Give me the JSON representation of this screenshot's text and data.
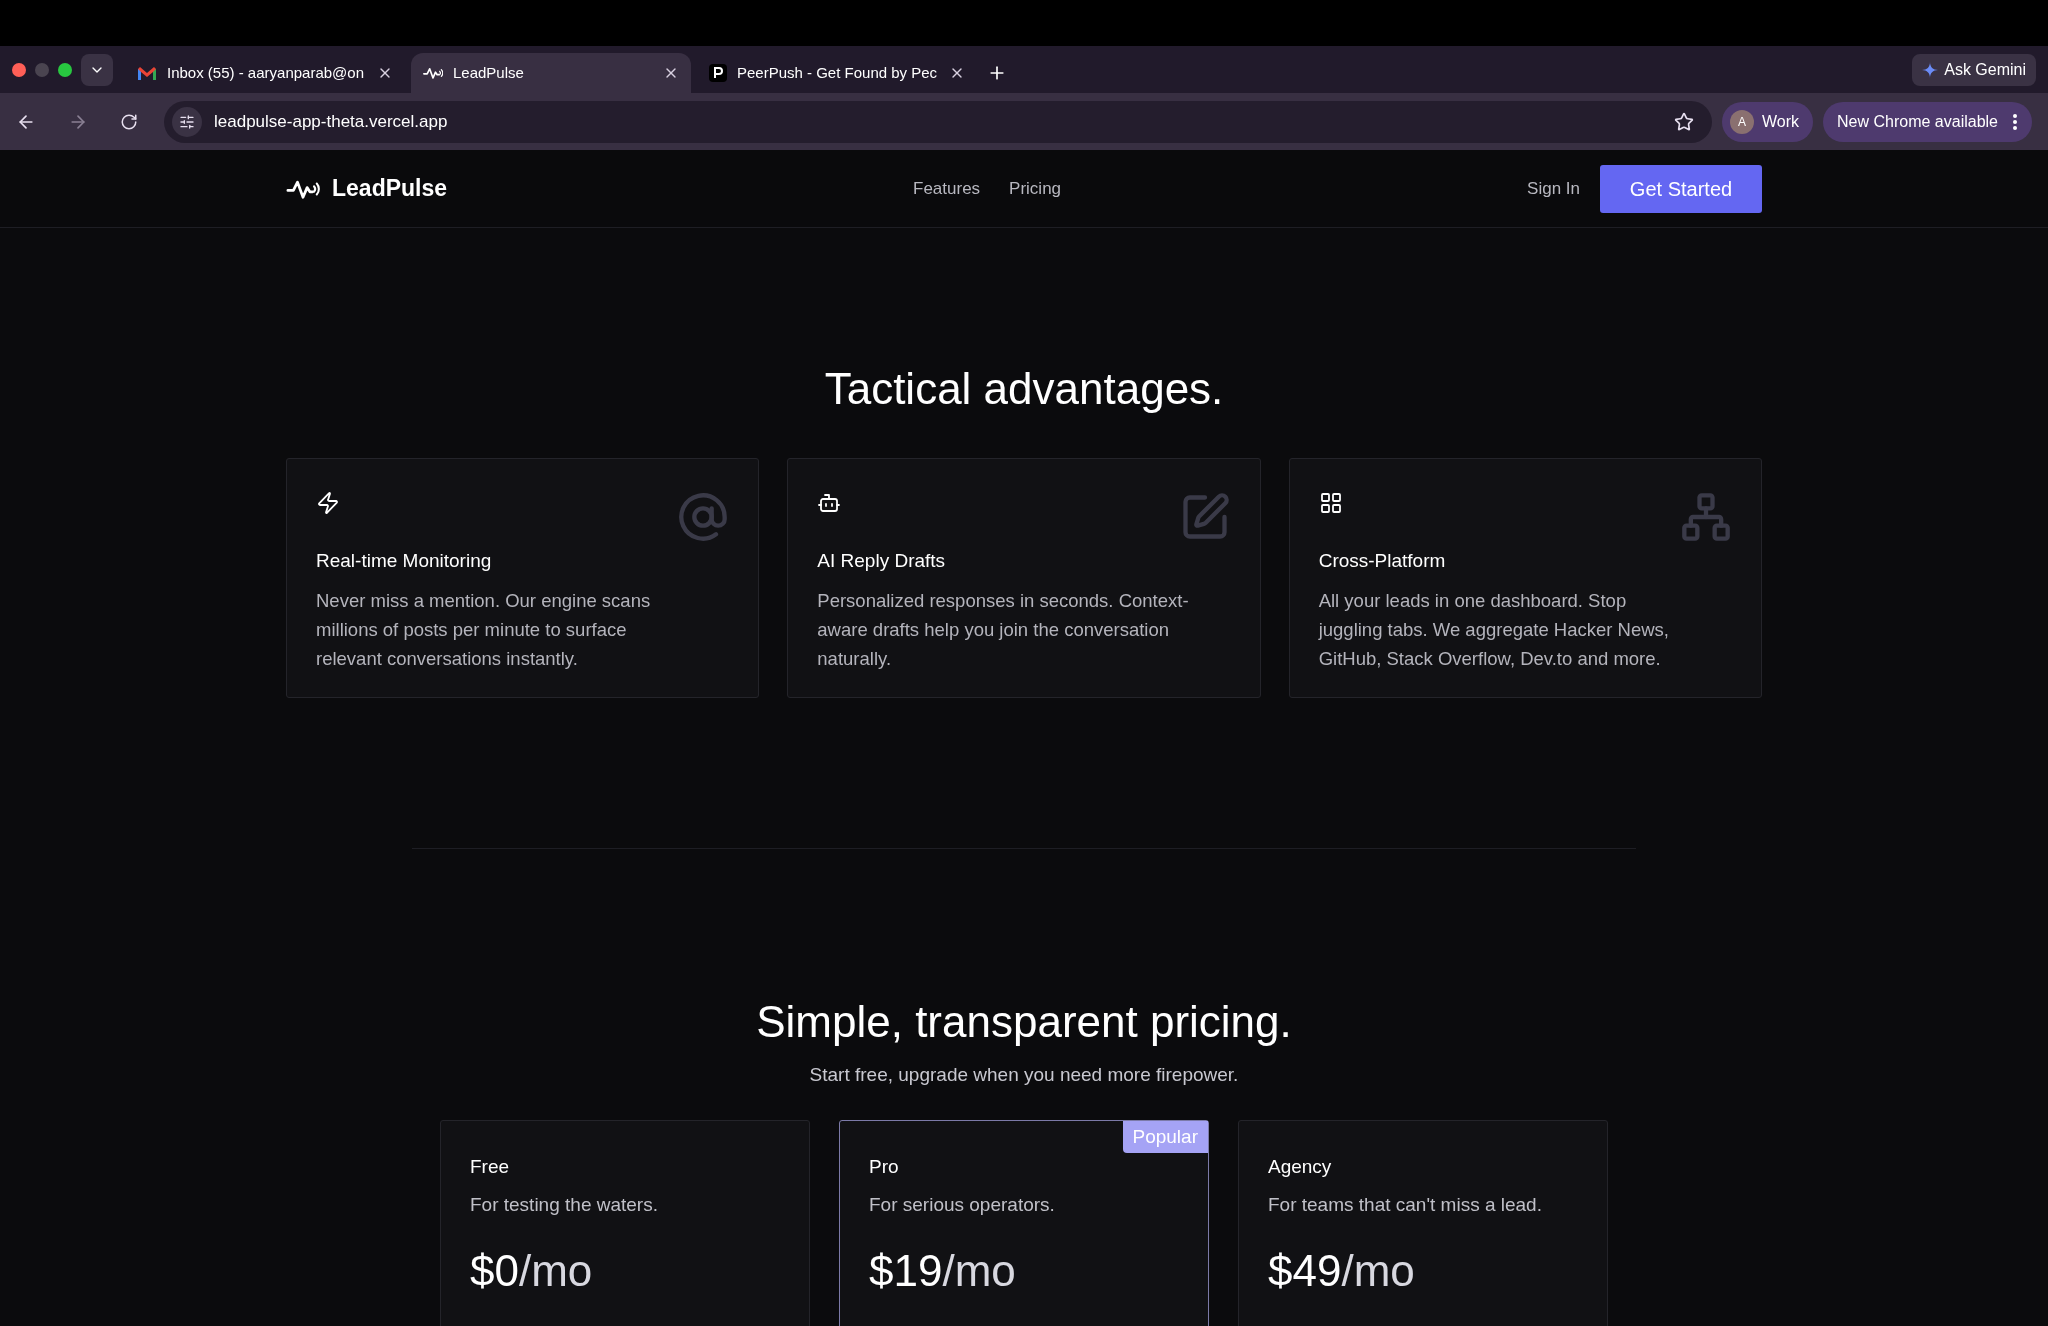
{
  "browser": {
    "tabs": [
      {
        "kind": "mail",
        "title": "Inbox (55) - aaryanparab@on",
        "selected": false
      },
      {
        "kind": "pulse",
        "title": "LeadPulse",
        "selected": true
      },
      {
        "kind": "peer",
        "title": "PeerPush - Get Found by Pec",
        "selected": false
      }
    ],
    "gemini": "Ask Gemini",
    "url": "leadpulse-app-theta.vercel.app",
    "profile_initial": "A",
    "profile": "Work",
    "update": "New Chrome available"
  },
  "nav": {
    "brand": "LeadPulse",
    "links": [
      "Features",
      "Pricing"
    ],
    "sign_in": "Sign In",
    "cta": "Get Started"
  },
  "features": {
    "title": "Tactical advantages.",
    "cards": [
      {
        "kind": "monitor",
        "title": "Real-time Monitoring",
        "text": "Never miss a mention. Our engine scans millions of posts per minute to surface relevant conversations instantly."
      },
      {
        "kind": "ai",
        "title": "AI Reply Drafts",
        "text": "Personalized responses in seconds. Context-aware drafts help you join the conversation naturally."
      },
      {
        "kind": "platform",
        "title": "Cross-Platform",
        "text": "All your leads in one dashboard. Stop juggling tabs. We aggregate Hacker News, GitHub, Stack Overflow, Dev.to and more."
      }
    ]
  },
  "pricing": {
    "title": "Simple, transparent pricing.",
    "subtitle": "Start free, upgrade when you need more firepower.",
    "plans": [
      {
        "name": "Free",
        "tagline": "For testing the waters.",
        "price": "$0",
        "period": "/mo",
        "highlighted": false
      },
      {
        "name": "Pro",
        "tagline": "For serious operators.",
        "price": "$19",
        "period": "/mo",
        "highlighted": true,
        "badge": "Popular"
      },
      {
        "name": "Agency",
        "tagline": "For teams that can't miss a lead.",
        "price": "$49",
        "period": "/mo",
        "highlighted": false
      }
    ]
  }
}
